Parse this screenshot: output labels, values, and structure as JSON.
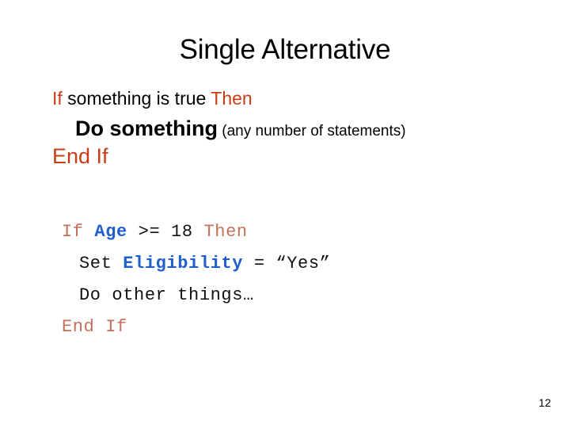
{
  "slide": {
    "title": "Single Alternative",
    "page_number": "12",
    "colors": {
      "background": "#ffffff",
      "heading_text": "#000000",
      "keyword_red": "#C83C17",
      "code_keyword_red": "#C4705A",
      "code_variable_blue": "#1F5FCC",
      "code_plain": "#111111"
    }
  },
  "pseudocode": {
    "line1": {
      "keyword_if": "If",
      "condition": " something is true ",
      "keyword_then": "Then"
    },
    "line2": {
      "action": "Do something",
      "note": " (any number of statements)"
    },
    "line3": {
      "keyword_end_if": "End If"
    }
  },
  "code_sample": {
    "line1": {
      "keyword_if": "If ",
      "variable": "Age",
      "operator": " >= 18 ",
      "keyword_then": "Then"
    },
    "line2": {
      "statement": "Set ",
      "variable": "Eligibility",
      "assignment": " = “Yes”"
    },
    "line3": {
      "statement": "Do other things…"
    },
    "line4": {
      "keyword_end_if": "End If"
    }
  }
}
